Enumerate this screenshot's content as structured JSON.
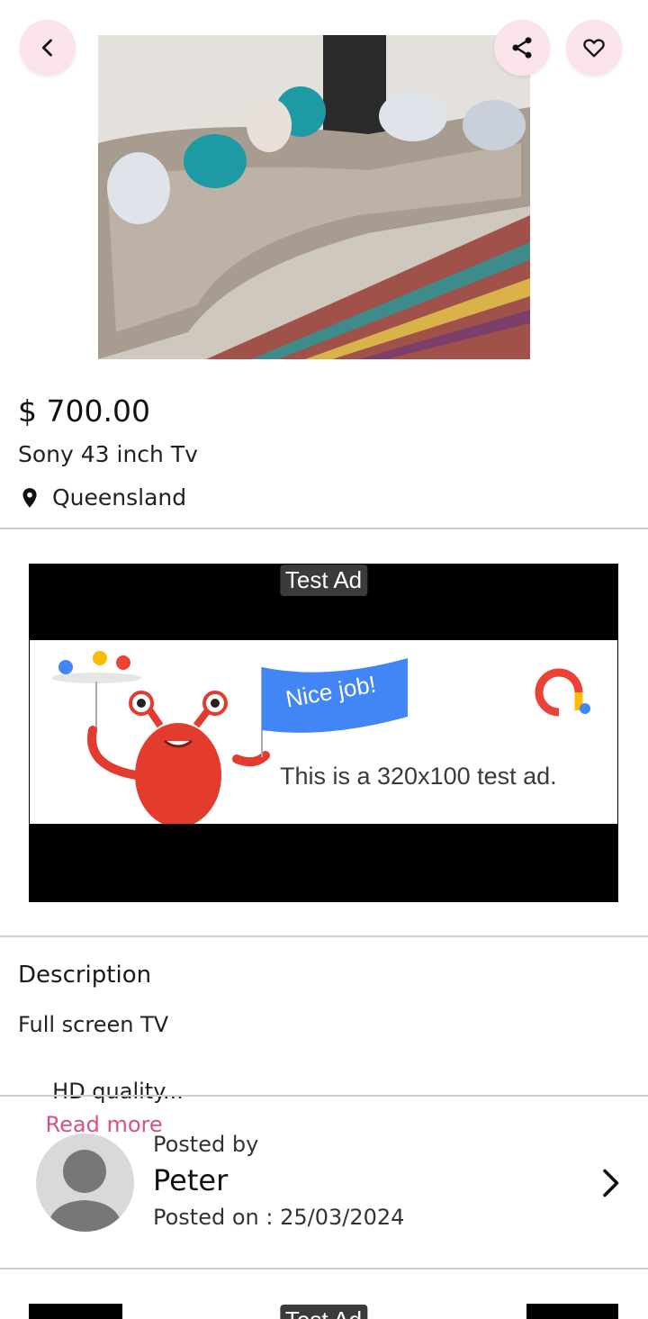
{
  "header": {
    "back_icon": "chevron-left-icon",
    "share_icon": "share-icon",
    "favorite_icon": "heart-icon",
    "accent_bg": "#fbe3ea"
  },
  "listing": {
    "price": "$ 700.00",
    "title": "Sony 43 inch Tv",
    "location": "Queensland"
  },
  "ad": {
    "label": "Test Ad",
    "flag_text": "Nice job!",
    "text": "This is a 320x100 test ad."
  },
  "description": {
    "heading": "Description",
    "line1": "Full screen TV",
    "line2": " HD quality...",
    "read_more": "Read more",
    "accent": "#d94f8a"
  },
  "seller": {
    "posted_by_label": "Posted by",
    "name": "Peter",
    "posted_on": "Posted on : 25/03/2024"
  },
  "ad2": {
    "label": "Test Ad"
  }
}
